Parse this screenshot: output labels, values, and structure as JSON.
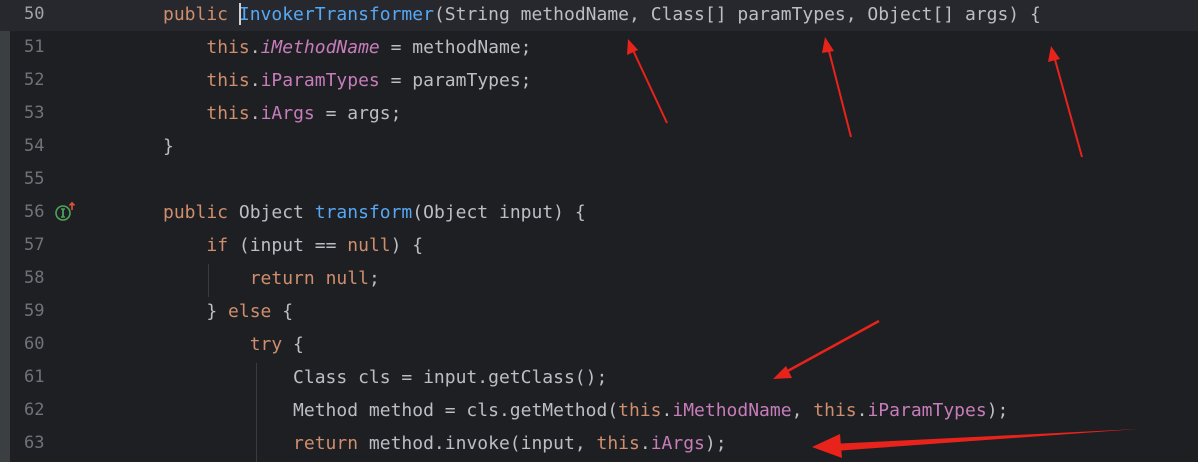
{
  "editor": {
    "current_line": "50",
    "lines": [
      {
        "number": "50",
        "tokens": [
          {
            "t": "public",
            "c": "kw"
          },
          {
            "t": " ",
            "c": ""
          },
          {
            "t": "InvokerTransformer",
            "c": "fn",
            "cursor": true
          },
          {
            "t": "(String methodName, Class[] paramTypes, Object[] args) {",
            "c": ""
          }
        ]
      },
      {
        "number": "51",
        "tokens": [
          {
            "t": "    ",
            "c": ""
          },
          {
            "t": "this",
            "c": "kw"
          },
          {
            "t": ".",
            "c": ""
          },
          {
            "t": "iMethodName",
            "c": "fld"
          },
          {
            "t": " = methodName;",
            "c": ""
          }
        ]
      },
      {
        "number": "52",
        "tokens": [
          {
            "t": "    ",
            "c": ""
          },
          {
            "t": "this",
            "c": "kw"
          },
          {
            "t": ".",
            "c": ""
          },
          {
            "t": "iParamTypes",
            "c": "fld"
          },
          {
            "t": " = paramTypes;",
            "c": ""
          }
        ]
      },
      {
        "number": "53",
        "tokens": [
          {
            "t": "    ",
            "c": ""
          },
          {
            "t": "this",
            "c": "kw"
          },
          {
            "t": ".",
            "c": ""
          },
          {
            "t": "iArgs",
            "c": "fld"
          },
          {
            "t": " = args;",
            "c": ""
          }
        ]
      },
      {
        "number": "54",
        "tokens": [
          {
            "t": "}",
            "c": ""
          }
        ]
      },
      {
        "number": "55",
        "tokens": []
      },
      {
        "number": "56",
        "gutter_icon": "implements-up-arrow-icon",
        "tokens": [
          {
            "t": "public",
            "c": "kw"
          },
          {
            "t": " Object ",
            "c": ""
          },
          {
            "t": "transform",
            "c": "fn"
          },
          {
            "t": "(Object input) {",
            "c": ""
          }
        ]
      },
      {
        "number": "57",
        "tokens": [
          {
            "t": "    ",
            "c": ""
          },
          {
            "t": "if",
            "c": "kw"
          },
          {
            "t": " (input == ",
            "c": ""
          },
          {
            "t": "null",
            "c": "kw"
          },
          {
            "t": ") {",
            "c": ""
          }
        ]
      },
      {
        "number": "58",
        "tokens": [
          {
            "t": "        ",
            "c": ""
          },
          {
            "t": "return",
            "c": "kw"
          },
          {
            "t": " ",
            "c": ""
          },
          {
            "t": "null",
            "c": "kw"
          },
          {
            "t": ";",
            "c": ""
          }
        ]
      },
      {
        "number": "59",
        "tokens": [
          {
            "t": "    } ",
            "c": ""
          },
          {
            "t": "else",
            "c": "kw"
          },
          {
            "t": " {",
            "c": ""
          }
        ]
      },
      {
        "number": "60",
        "tokens": [
          {
            "t": "        ",
            "c": ""
          },
          {
            "t": "try",
            "c": "kw"
          },
          {
            "t": " {",
            "c": ""
          }
        ]
      },
      {
        "number": "61",
        "tokens": [
          {
            "t": "            Class cls = input.getClass();",
            "c": ""
          }
        ]
      },
      {
        "number": "62",
        "tokens": [
          {
            "t": "            Method method = cls.getMethod(",
            "c": ""
          },
          {
            "t": "this",
            "c": "kw"
          },
          {
            "t": ".",
            "c": ""
          },
          {
            "t": "iMethodName",
            "c": "fld"
          },
          {
            "t": ", ",
            "c": ""
          },
          {
            "t": "this",
            "c": "kw"
          },
          {
            "t": ".",
            "c": ""
          },
          {
            "t": "iParamTypes",
            "c": "fld"
          },
          {
            "t": ");",
            "c": ""
          }
        ]
      },
      {
        "number": "63",
        "tokens": [
          {
            "t": "            ",
            "c": ""
          },
          {
            "t": "return",
            "c": "kw"
          },
          {
            "t": " method.invoke(input, ",
            "c": ""
          },
          {
            "t": "this",
            "c": "kw"
          },
          {
            "t": ".",
            "c": ""
          },
          {
            "t": "iArgs",
            "c": "fld"
          },
          {
            "t": ");",
            "c": ""
          }
        ]
      }
    ]
  },
  "colors": {
    "background": "#1e1f22",
    "keyword": "#cf8e6d",
    "method": "#56a8f5",
    "field": "#c77dbb",
    "text": "#bcbec4",
    "line_number": "#6f737a",
    "annotation_arrow": "#e8231c"
  }
}
